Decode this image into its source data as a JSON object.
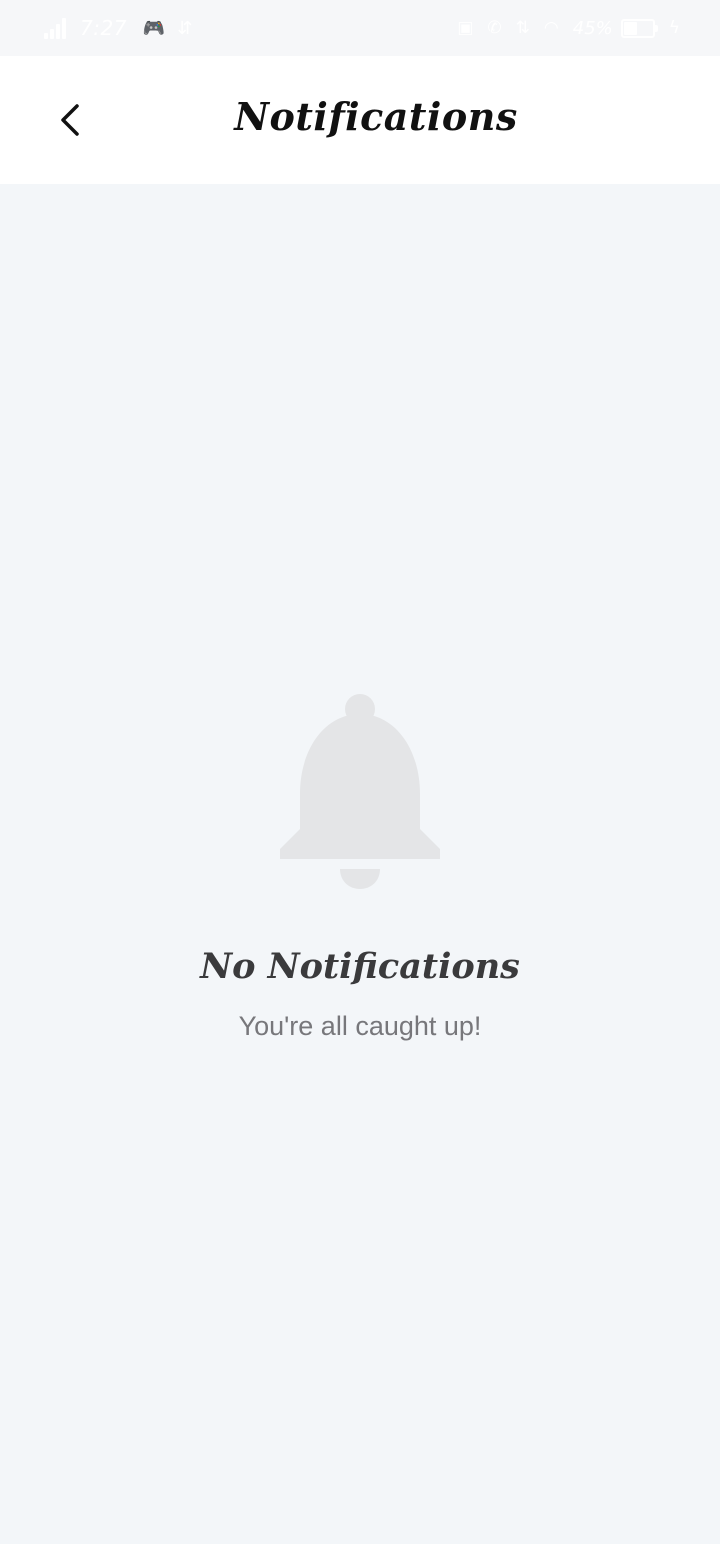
{
  "status_bar": {
    "time": "7:27",
    "battery_percent": "45%",
    "battery_level": 0.45,
    "left_icons": [
      "game-controller-icon",
      "usb-icon"
    ],
    "right_icons": [
      "nfc-icon",
      "volte-icon",
      "data-speed-icon",
      "wifi-icon"
    ]
  },
  "header": {
    "title": "Notifications",
    "back_icon": "chevron-left-icon"
  },
  "empty_state": {
    "icon": "bell-icon",
    "icon_color": "#e4e5e7",
    "title": "No Notifications",
    "subtitle": "You're all caught up!"
  },
  "colors": {
    "background": "#f3f6f9",
    "header_background": "#ffffff",
    "title_text": "#111111",
    "empty_title_text": "#3a3a3c",
    "empty_subtitle_text": "#77777b"
  }
}
